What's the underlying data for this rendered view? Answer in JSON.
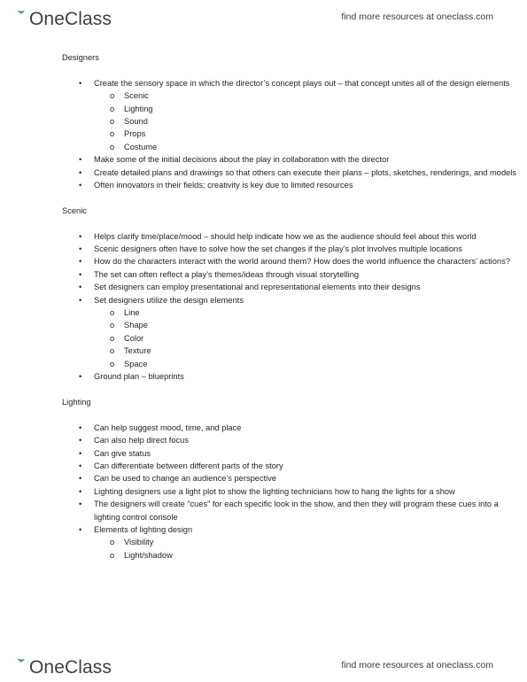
{
  "brand": {
    "name": "OneClass",
    "logo_icon": "sprout-o-logo",
    "leaf_color": "#2e7d52",
    "wordmark_color": "#3f3f3f",
    "tagline": "find more resources at oneclass.com"
  },
  "document": {
    "sections": [
      {
        "title": "Designers",
        "bullets": [
          {
            "text": "Create the sensory space in which the director’s concept plays out – that concept unites all of the design elements",
            "subbullets": [
              "Scenic",
              "Lighting",
              "Sound",
              "Props",
              "Costume"
            ]
          },
          {
            "text": "Make some of the initial decisions about the play in collaboration with the director",
            "subbullets": []
          },
          {
            "text": "Create detailed plans and drawings so that others can execute their plans – plots, sketches, renderings, and models",
            "subbullets": []
          },
          {
            "text": "Often innovators in their fields; creativity is key due to limited resources",
            "subbullets": []
          }
        ]
      },
      {
        "title": "Scenic",
        "bullets": [
          {
            "text": "Helps clarify time/place/mood – should help indicate how we as the audience should feel about this world",
            "subbullets": []
          },
          {
            "text": "Scenic designers often have to solve how the set changes if the play’s plot involves multiple locations",
            "subbullets": []
          },
          {
            "text": "How do the characters interact with the world around them? How does the world influence the characters’ actions?",
            "subbullets": []
          },
          {
            "text": "The set can often reflect a play’s themes/ideas through visual storytelling",
            "subbullets": []
          },
          {
            "text": "Set designers can employ presentational and representational elements into their designs",
            "subbullets": []
          },
          {
            "text": "Set designers utilize the design elements",
            "subbullets": [
              "Line",
              "Shape",
              "Color",
              "Texture",
              "Space"
            ]
          },
          {
            "text": "Ground plan – blueprints",
            "subbullets": []
          }
        ]
      },
      {
        "title": "Lighting",
        "bullets": [
          {
            "text": "Can help suggest mood, time, and place",
            "subbullets": []
          },
          {
            "text": "Can also help direct focus",
            "subbullets": []
          },
          {
            "text": "Can give status",
            "subbullets": []
          },
          {
            "text": "Can differentiate between different parts of the story",
            "subbullets": []
          },
          {
            "text": "Can be used to change an audience’s perspective",
            "subbullets": []
          },
          {
            "text": "Lighting designers use a light plot to show the lighting technicians how to hang the lights for a show",
            "subbullets": []
          },
          {
            "text": "The designers will create “cues” for each specific look in the show, and then they will program these cues into a lighting control console",
            "subbullets": []
          },
          {
            "text": "Elements of lighting design",
            "subbullets": [
              "Visibility",
              "Light/shadow"
            ]
          }
        ]
      }
    ],
    "bullet_marker": "•",
    "subbullet_marker": "o"
  }
}
